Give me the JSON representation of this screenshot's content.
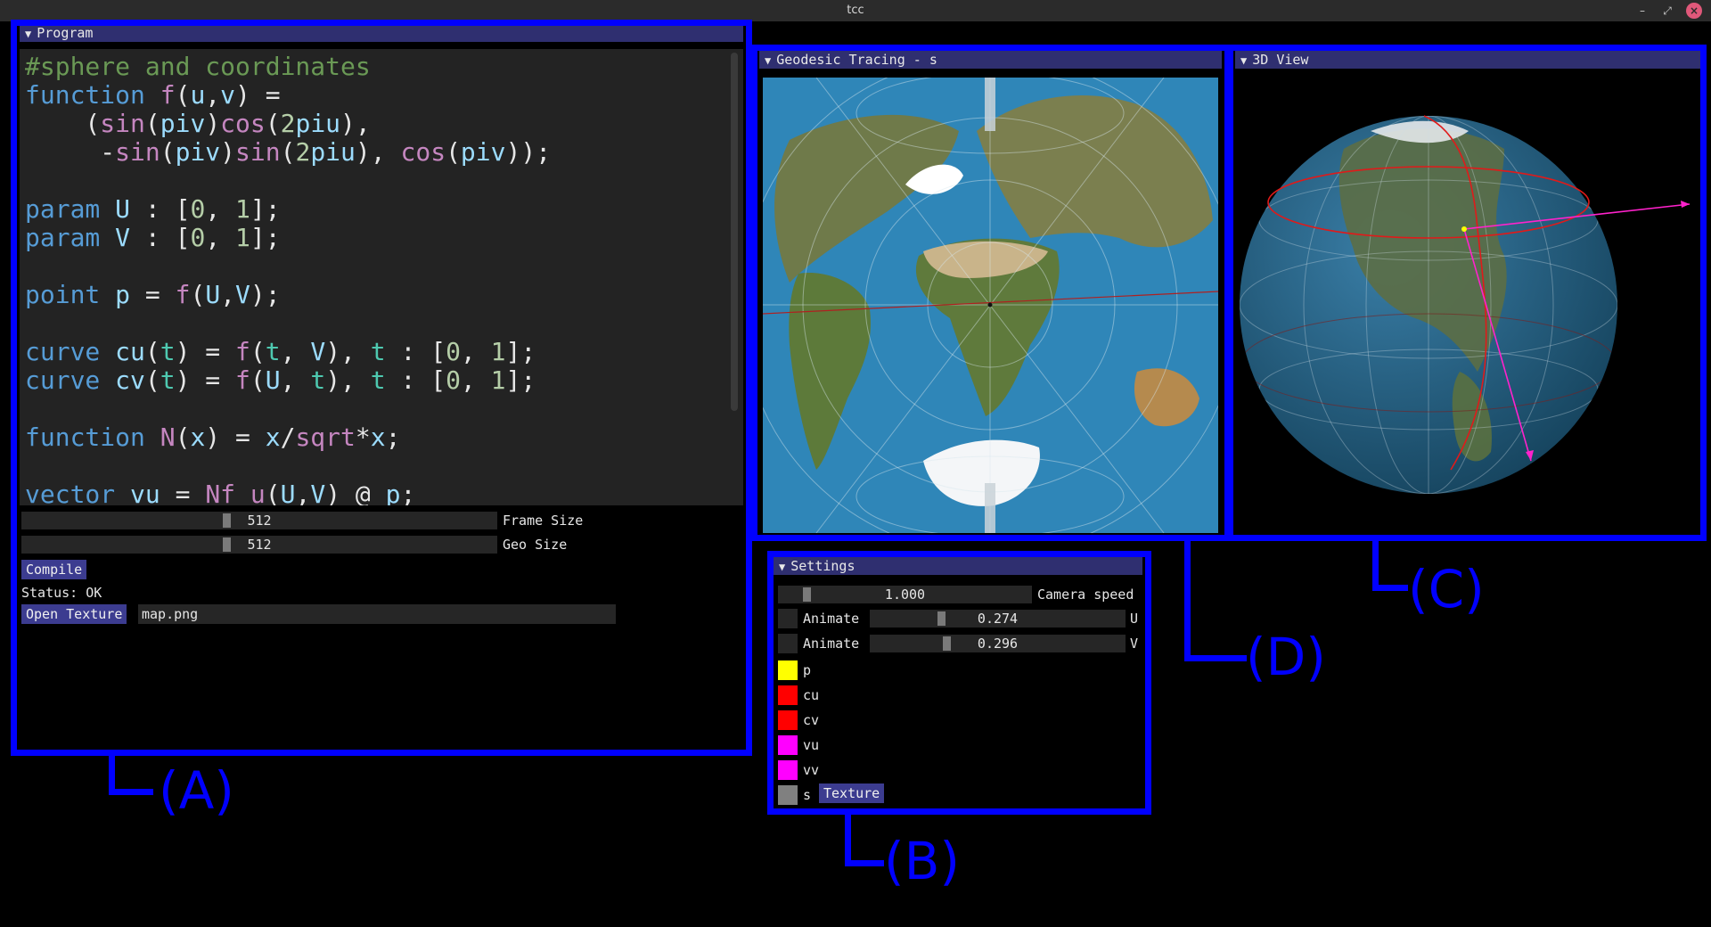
{
  "window": {
    "title": "tcc"
  },
  "program": {
    "title": "Program",
    "code_lines": [
      "#sphere and coordinates",
      "function f(u,v) =",
      "    (sin(piv)cos(2piu),",
      "     -sin(piv)sin(2piu), cos(piv));",
      "",
      "param U : [0, 1];",
      "param V : [0, 1];",
      "",
      "point p = f(U,V);",
      "",
      "curve cu(t) = f(t, V), t : [0, 1];",
      "curve cv(t) = f(U, t), t : [0, 1];",
      "",
      "function N(x) = x/sqrt*x;",
      "",
      "vector vu = Nf_u(U,V) @ p;"
    ],
    "frame_size": {
      "value": "512",
      "label": "Frame Size",
      "fraction": 0.43
    },
    "geo_size": {
      "value": "512",
      "label": "Geo Size",
      "fraction": 0.43
    },
    "compile_label": "Compile",
    "status": "Status: OK",
    "open_texture_label": "Open Texture",
    "texture_file": "map.png"
  },
  "geodesic": {
    "title": "Geodesic Tracing - s"
  },
  "view3d": {
    "title": "3D View"
  },
  "settings": {
    "title": "Settings",
    "camera_speed": {
      "value": "1.000",
      "label": "Camera speed",
      "fraction": 0.1
    },
    "u": {
      "animate_label": "Animate",
      "value": "0.274",
      "label": "U",
      "fraction": 0.274
    },
    "v": {
      "animate_label": "Animate",
      "value": "0.296",
      "label": "V",
      "fraction": 0.296
    },
    "objects": [
      {
        "name": "p",
        "color": "#ffff00"
      },
      {
        "name": "cu",
        "color": "#ff0000"
      },
      {
        "name": "cv",
        "color": "#ff0000"
      },
      {
        "name": "vu",
        "color": "#ff00ff"
      },
      {
        "name": "vv",
        "color": "#ff00ff"
      },
      {
        "name": "s",
        "color": "#808080"
      }
    ],
    "texture_button": "Texture"
  },
  "annotations": {
    "a": "(A)",
    "b": "(B)",
    "c": "(C)",
    "d": "(D)"
  },
  "colors": {
    "annotation": "#0000ff",
    "title_bar": "#2f2f70",
    "button": "#3c3c90"
  }
}
